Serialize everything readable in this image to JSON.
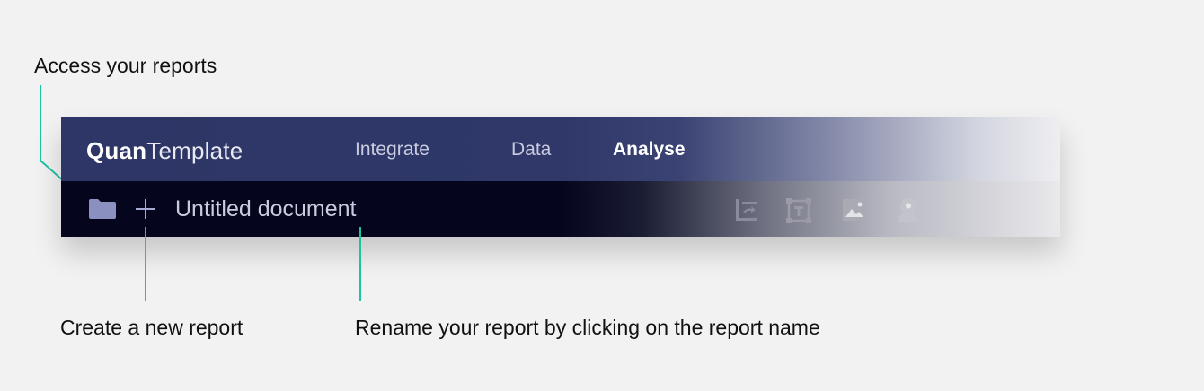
{
  "annotations": {
    "access_reports": "Access your reports",
    "create_report": "Create a new report",
    "rename_report": "Rename your report by clicking on the report name"
  },
  "app": {
    "logo_bold": "Quan",
    "logo_light": "Template",
    "nav": [
      {
        "label": "Integrate",
        "active": false
      },
      {
        "label": "Data",
        "active": false
      },
      {
        "label": "Analyse",
        "active": true
      }
    ],
    "document_name": "Untitled document",
    "toolbar_icons": [
      "folder-icon",
      "plus-icon",
      "swap-chart-icon",
      "text-box-icon",
      "image-icon",
      "map-pin-icon"
    ]
  },
  "colors": {
    "topbar": "#2d3666",
    "subbar": "#05061d",
    "accent_line": "#1ec3a4",
    "icon": "#8a90c0"
  }
}
